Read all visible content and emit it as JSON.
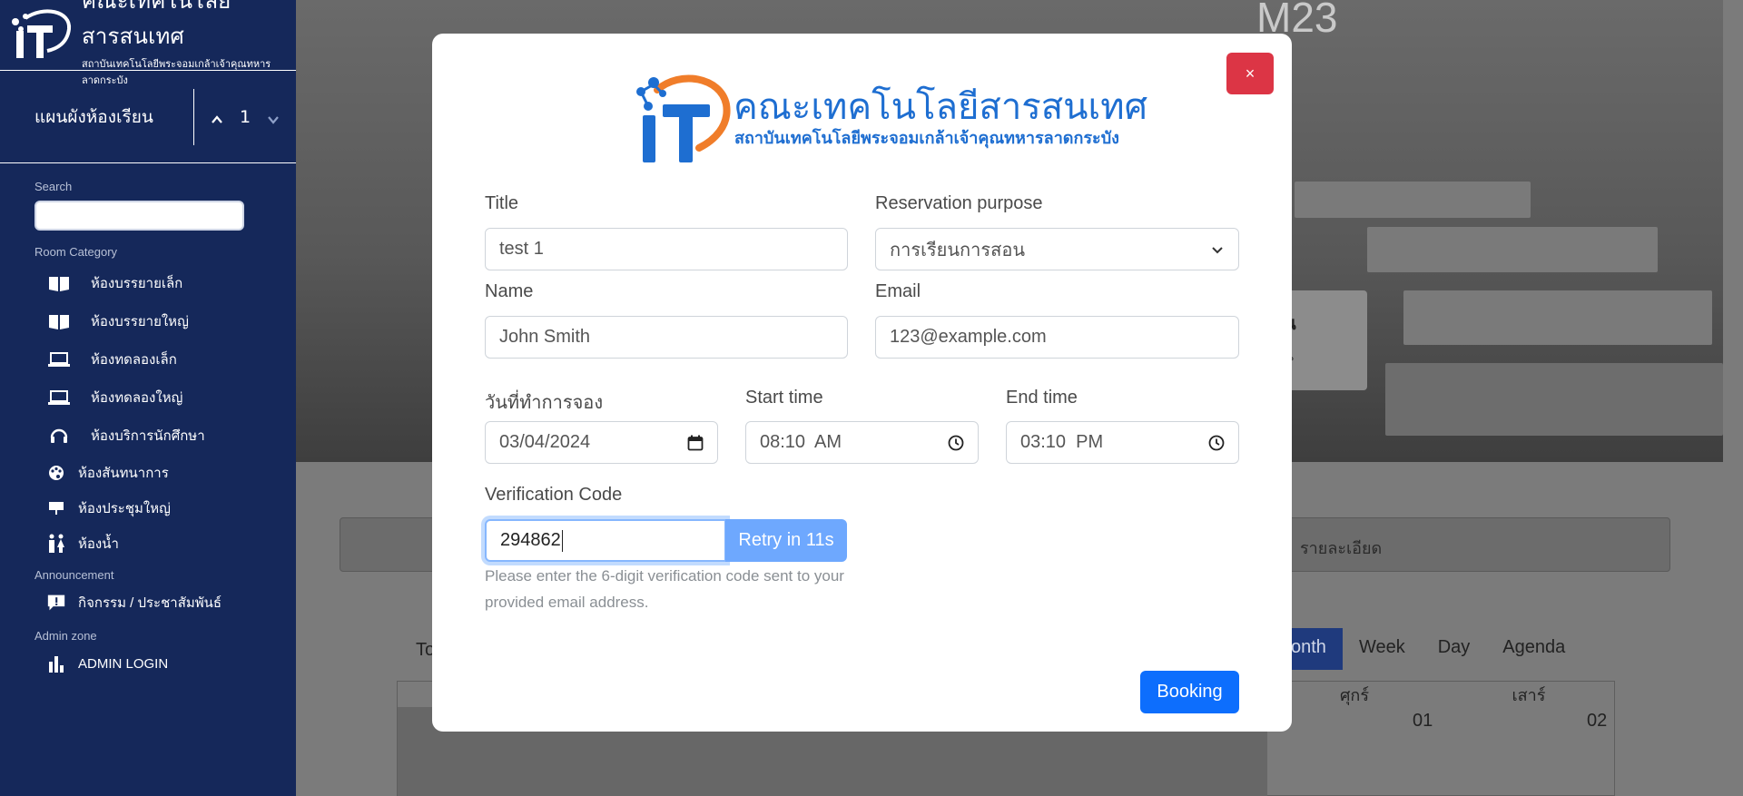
{
  "sidebar": {
    "brand_title": "คณะเทคโนโลยีสารสนเทศ",
    "brand_subtitle": "สถาบันเทคโนโลยีพระจอมเกล้าเจ้าคุณทหารลาดกระบัง",
    "floor_label": "แผนผังห้องเรียน",
    "floor_value": "1",
    "search_label": "Search",
    "search_placeholder": "",
    "room_category_label": "Room Category",
    "rooms": [
      {
        "label": "ห้องบรรยายเล็ก",
        "icon": "book-icon"
      },
      {
        "label": "ห้องบรรยายใหญ่",
        "icon": "book-icon"
      },
      {
        "label": "ห้องทดลองเล็ก",
        "icon": "laptop-icon"
      },
      {
        "label": "ห้องทดลองใหญ่",
        "icon": "laptop-icon"
      },
      {
        "label": "ห้องบริการนักศึกษา",
        "icon": "headset-icon"
      },
      {
        "label": "ห้องสันทนาการ",
        "icon": "palette-icon"
      },
      {
        "label": "ห้องประชุมใหญ่",
        "icon": "presentation-icon"
      },
      {
        "label": "ห้องน้ำ",
        "icon": "restroom-icon"
      }
    ],
    "announcement_label": "Announcement",
    "announcement_item": "กิจกรรม / ประชาสัมพันธ์",
    "admin_label": "Admin zone",
    "admin_item": "ADMIN LOGIN"
  },
  "background": {
    "room_code": "M23",
    "detail_label": "รายละเอียด",
    "today_label": "To",
    "views": [
      "onth",
      "Week",
      "Day",
      "Agenda"
    ],
    "day_heads": [
      "ศุกร์",
      "เสาร์"
    ],
    "day_nums": [
      "01",
      "02"
    ]
  },
  "modal": {
    "close_label": "×",
    "logo_title": "คณะเทคโนโลยีสารสนเทศ",
    "logo_subtitle": "สถาบันเทคโนโลยีพระจอมเกล้าเจ้าคุณทหารลาดกระบัง",
    "title_label": "Title",
    "title_value": "test 1",
    "purpose_label": "Reservation purpose",
    "purpose_value": "การเรียนการสอน",
    "name_label": "Name",
    "name_value": "John Smith",
    "email_label": "Email",
    "email_value": "123@example.com",
    "date_label": "วันที่ทำการจอง",
    "date_value": "03/04/2024",
    "start_label": "Start time",
    "start_value": "08:10  AM",
    "end_label": "End time",
    "end_value": "03:10  PM",
    "code_label": "Verification Code",
    "code_value": "294862",
    "retry_label": "Retry in 11s",
    "help_text": "Please enter the 6-digit verification code sent to your provided email address.",
    "booking_label": "Booking"
  },
  "colors": {
    "sidebar_bg": "#15285a",
    "primary": "#0d6efd",
    "danger": "#dc3545",
    "retry_disabled": "#6ea8fe",
    "logo_blue": "#1e6ed1",
    "logo_orange": "#f07d2a"
  }
}
